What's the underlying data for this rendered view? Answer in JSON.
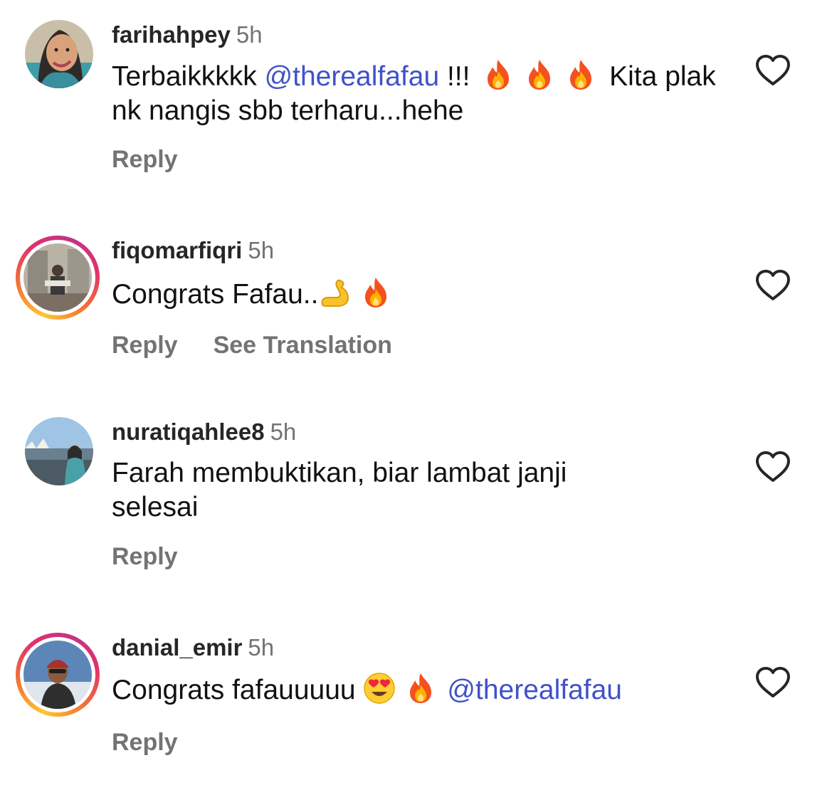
{
  "colors": {
    "username": "#262626",
    "meta": "#737373",
    "text": "#111111",
    "mention": "#3f52c9",
    "story_ring": [
      "#fdc830",
      "#f37335",
      "#e1306c",
      "#c13584"
    ]
  },
  "comments": [
    {
      "username": "farihahpey",
      "time": "5h",
      "text_parts": [
        "Terbaikkkkk ",
        "@therealfafau",
        " !!! ",
        " Kita plak nk nangis sbb terharu...hehe"
      ],
      "emojis": [
        "fire",
        "fire",
        "fire"
      ],
      "actions": [
        "Reply"
      ],
      "has_story_ring": false,
      "liked": false
    },
    {
      "username": "fiqomarfiqri",
      "time": "5h",
      "text_parts": [
        "Congrats Fafau.."
      ],
      "emojis": [
        "flexed-biceps",
        "fire"
      ],
      "actions": [
        "Reply",
        "See Translation"
      ],
      "has_story_ring": true,
      "liked": false
    },
    {
      "username": "nuratiqahlee8",
      "time": "5h",
      "text_parts": [
        "Farah membuktikan, biar lambat janji selesai"
      ],
      "emojis": [],
      "actions": [
        "Reply"
      ],
      "has_story_ring": false,
      "liked": false
    },
    {
      "username": "danial_emir",
      "time": "5h",
      "text_parts": [
        "Congrats fafauuuuu ",
        "@therealfafau"
      ],
      "emojis": [
        "heart-eyes",
        "fire"
      ],
      "actions": [
        "Reply"
      ],
      "has_story_ring": true,
      "liked": false
    }
  ]
}
